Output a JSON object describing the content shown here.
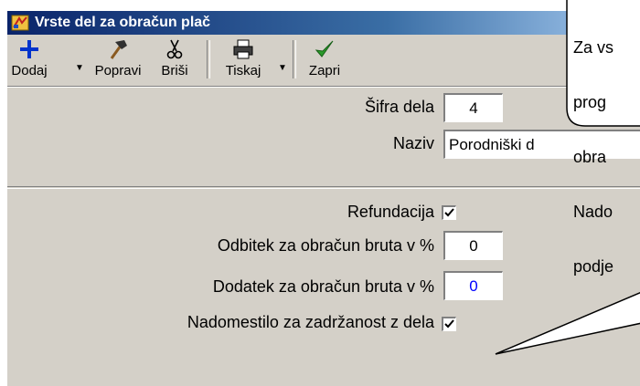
{
  "window": {
    "title": "Vrste del za obračun plač"
  },
  "toolbar": {
    "add_label": "Dodaj",
    "edit_label": "Popravi",
    "delete_label": "Briši",
    "print_label": "Tiskaj",
    "close_label": "Zapri",
    "icons": {
      "add": "plus-icon",
      "edit": "hammer-icon",
      "delete": "scissors-icon",
      "print": "printer-icon",
      "close": "checkmark-icon"
    }
  },
  "form": {
    "code_label": "Šifra dela",
    "code_value": "4",
    "name_label": "Naziv",
    "name_value": "Porodniški d",
    "refund_label": "Refundacija",
    "refund_checked": true,
    "deduction_label": "Odbitek za obračun bruta v %",
    "deduction_value": "0",
    "addition_label": "Dodatek za obračun bruta v %",
    "addition_value": "0",
    "compensation_label": "Nadomestilo za zadržanost z dela",
    "compensation_checked": true
  },
  "callouts": {
    "top_text_lines": [
      "Za vs",
      "prog",
      "obra",
      "Nado",
      "podje"
    ]
  },
  "colors": {
    "titlebar_start": "#0a246a",
    "titlebar_end": "#a6caf0",
    "window_bg": "#d4d0c8",
    "blue_value": "#0000ff",
    "check_green": "#2a9a2a"
  }
}
